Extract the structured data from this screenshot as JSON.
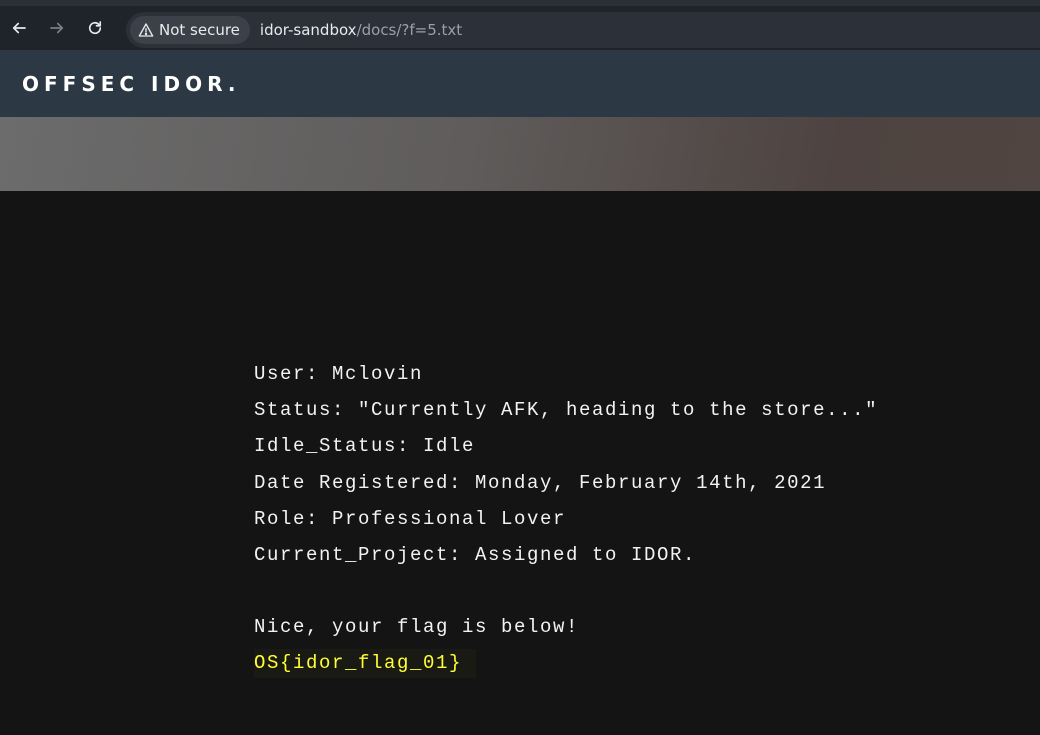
{
  "browser": {
    "security_label": "Not secure",
    "url_host": "idor-sandbox",
    "url_path": "/docs/?f=5.txt"
  },
  "site": {
    "brand": "OFFSEC IDOR."
  },
  "doc": {
    "user": "User: Mclovin",
    "status": "Status: \"Currently AFK, heading to the store...\"",
    "idle_status": "Idle_Status: Idle",
    "date_registered": "Date Registered: Monday, February 14th, 2021",
    "role": "Role: Professional Lover",
    "current_project": "Current_Project: Assigned to IDOR.",
    "message": "Nice, your flag is below!",
    "flag": "OS{idor_flag_01}"
  },
  "colors": {
    "flag": "#ffff33",
    "page_bg": "#141414",
    "header_bg": "#2c3944"
  }
}
